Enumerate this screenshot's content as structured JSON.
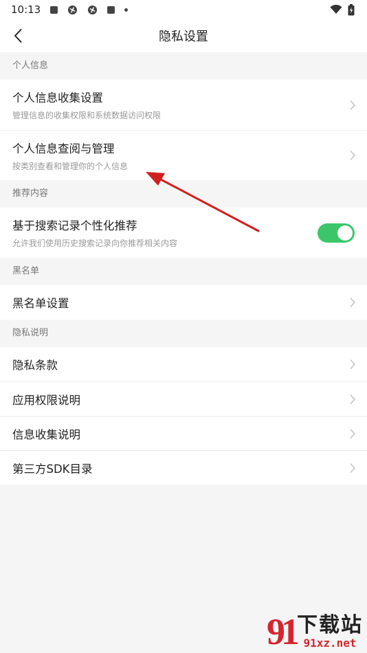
{
  "status_bar": {
    "time": "10:13"
  },
  "header": {
    "title": "隐私设置"
  },
  "sections": [
    {
      "label": "个人信息"
    },
    {
      "label": "推荐内容"
    },
    {
      "label": "黑名单"
    },
    {
      "label": "隐私说明"
    }
  ],
  "items": {
    "collect": {
      "title": "个人信息收集设置",
      "subtitle": "管理信息的收集权限和系统数据访问权限"
    },
    "view": {
      "title": "个人信息查阅与管理",
      "subtitle": "按类别查看和管理你的个人信息"
    },
    "recommend": {
      "title": "基于搜索记录个性化推荐",
      "subtitle": "允许我们使用历史搜索记录向你推荐相关内容",
      "enabled": true
    },
    "blacklist": {
      "title": "黑名单设置"
    },
    "terms": {
      "title": "隐私条款"
    },
    "permissions": {
      "title": "应用权限说明"
    },
    "collection_notice": {
      "title": "信息收集说明"
    },
    "sdk": {
      "title": "第三方SDK目录"
    }
  },
  "colors": {
    "toggle_on": "#3cc66a",
    "annotation_arrow": "#d11f1f",
    "watermark_red": "#d6252e"
  },
  "watermark": {
    "logo": "91",
    "name": "下载站",
    "url": "91xz.net"
  }
}
